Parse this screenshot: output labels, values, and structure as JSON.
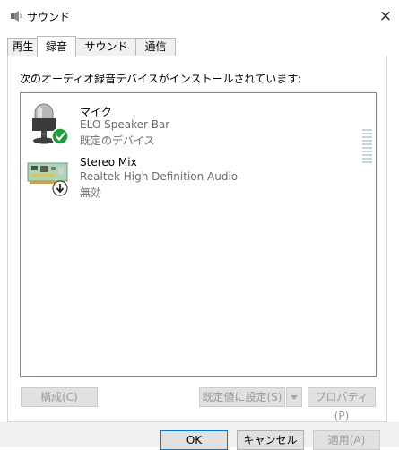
{
  "window": {
    "title": "サウンド",
    "close_glyph": "×"
  },
  "tabs": [
    {
      "label": "再生"
    },
    {
      "label": "録音"
    },
    {
      "label": "サウンド"
    },
    {
      "label": "通信"
    }
  ],
  "active_tab": "録音",
  "instruction": "次のオーディオ録音デバイスがインストールされています:",
  "devices": [
    {
      "name": "マイク",
      "description": "ELO Speaker Bar",
      "status": "既定のデバイス",
      "icon": "microphone-icon",
      "badge": "default-check-icon",
      "badge_color": "#1e9d3c"
    },
    {
      "name": "Stereo Mix",
      "description": "Realtek High Definition Audio",
      "status": "無効",
      "icon": "sound-card-icon",
      "badge": "disabled-arrow-icon"
    }
  ],
  "buttons": {
    "configure": "構成(C)",
    "set_default": "既定値に設定(S)",
    "properties": "プロパティ(P)",
    "ok": "OK",
    "cancel": "キャンセル",
    "apply": "適用(A)"
  },
  "colors": {
    "accent": "#0078d7",
    "status_gray": "#6d6d6d"
  }
}
